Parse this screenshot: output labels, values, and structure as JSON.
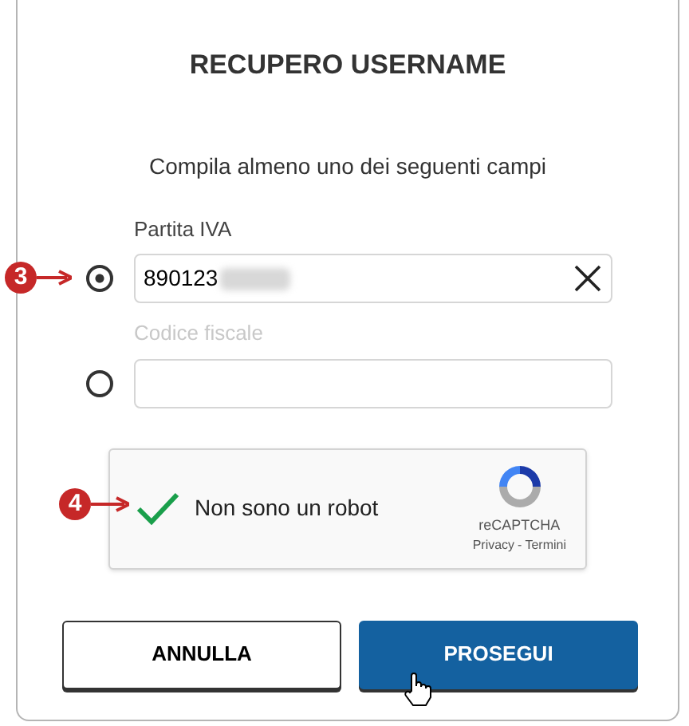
{
  "title": "RECUPERO USERNAME",
  "instructions": "Compila almeno uno dei seguenti campi",
  "fields": [
    {
      "label": "Partita IVA",
      "value": "890123",
      "redacted": true,
      "selected": true,
      "disabled": false,
      "clearable": true,
      "callout": "3"
    },
    {
      "label": "Codice fiscale",
      "redacted": false,
      "selected": false,
      "disabled": true,
      "clearable": false
    }
  ],
  "captcha": {
    "label": "Non sono un robot",
    "checked": true,
    "brand": "reCAPTCHA",
    "privacy": "Privacy",
    "separator": "-",
    "terms": "Termini",
    "callout": "4"
  },
  "buttons": [
    {
      "label": "ANNULLA",
      "kind": "secondary"
    },
    {
      "label": "PROSEGUI",
      "kind": "primary"
    }
  ]
}
